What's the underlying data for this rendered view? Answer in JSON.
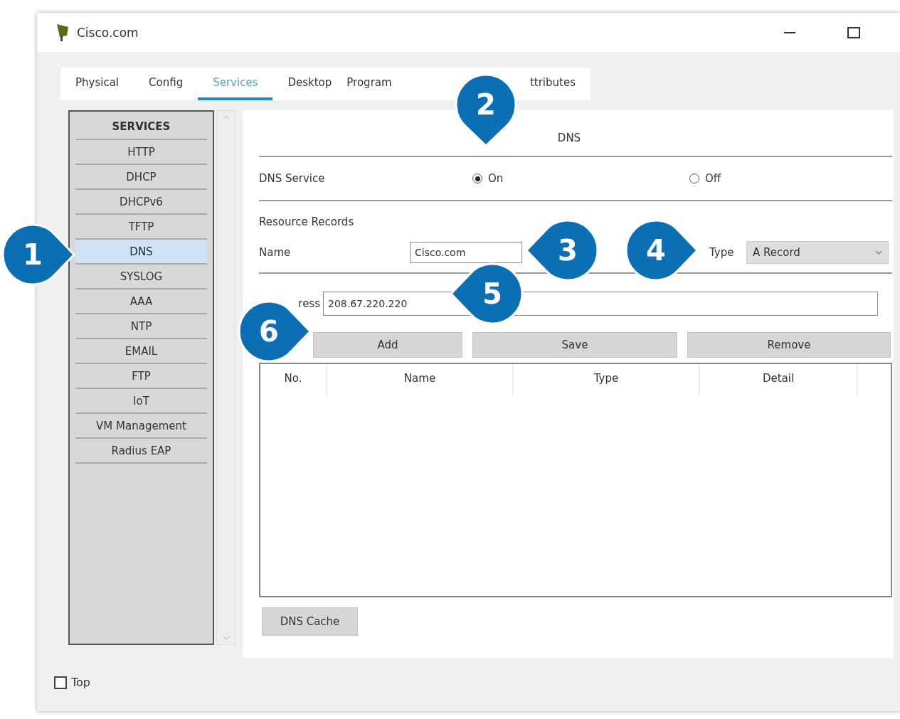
{
  "window": {
    "title": "Cisco.com"
  },
  "tabs": [
    {
      "label": "Physical",
      "selected": false
    },
    {
      "label": "Config",
      "selected": false
    },
    {
      "label": "Services",
      "selected": true
    },
    {
      "label": "Desktop",
      "selected": false
    },
    {
      "label": "Program",
      "selected": false
    },
    {
      "label": "ttributes",
      "selected": false
    }
  ],
  "services": {
    "header": "SERVICES",
    "items": [
      {
        "label": "HTTP",
        "selected": false
      },
      {
        "label": "DHCP",
        "selected": false
      },
      {
        "label": "DHCPv6",
        "selected": false
      },
      {
        "label": "TFTP",
        "selected": false
      },
      {
        "label": "DNS",
        "selected": true
      },
      {
        "label": "SYSLOG",
        "selected": false
      },
      {
        "label": "AAA",
        "selected": false
      },
      {
        "label": "NTP",
        "selected": false
      },
      {
        "label": "EMAIL",
        "selected": false
      },
      {
        "label": "FTP",
        "selected": false
      },
      {
        "label": "IoT",
        "selected": false
      },
      {
        "label": "VM Management",
        "selected": false
      },
      {
        "label": "Radius EAP",
        "selected": false
      }
    ]
  },
  "dns": {
    "title": "DNS",
    "service_label": "DNS Service",
    "options": [
      {
        "label": "On",
        "selected": true
      },
      {
        "label": "Off",
        "selected": false
      }
    ],
    "records_label": "Resource Records",
    "name_label": "Name",
    "name_value": "Cisco.com",
    "type_label": "Type",
    "type_value": "A Record",
    "address_label": "ress",
    "address_value": "208.67.220.220",
    "buttons": [
      "Add",
      "Save",
      "Remove"
    ],
    "columns": [
      "No.",
      "Name",
      "Type",
      "Detail"
    ],
    "cache_button": "DNS Cache"
  },
  "top": {
    "label": "Top",
    "checked": false
  },
  "callouts": [
    "1",
    "2",
    "3",
    "4",
    "5",
    "6"
  ]
}
